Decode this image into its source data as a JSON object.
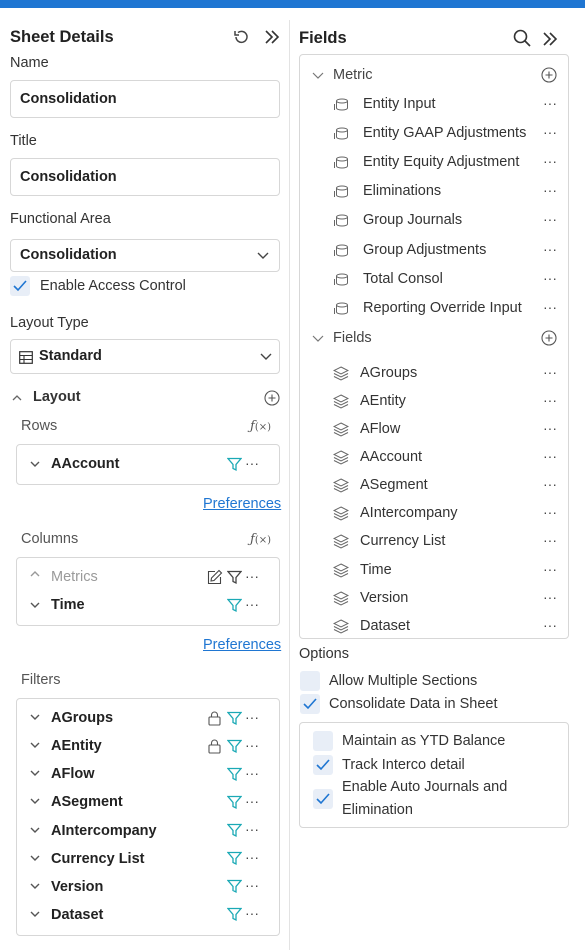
{
  "left": {
    "title": "Sheet Details",
    "name_label": "Name",
    "name_value": "Consolidation",
    "title_label": "Title",
    "title_value": "Consolidation",
    "functional_area_label": "Functional Area",
    "functional_area_value": "Consolidation",
    "enable_access_control": "Enable Access Control",
    "layout_type_label": "Layout Type",
    "layout_type_value": "Standard",
    "layout_section": "Layout",
    "rows_label": "Rows",
    "rows": [
      "AAccount"
    ],
    "preferences_1": "Preferences",
    "columns_label": "Columns",
    "columns": [
      "Metrics",
      "Time"
    ],
    "preferences_2": "Preferences",
    "filters_label": "Filters",
    "filters": [
      "AGroups",
      "AEntity",
      "AFlow",
      "ASegment",
      "AIntercompany",
      "Currency List",
      "Version",
      "Dataset"
    ]
  },
  "right": {
    "title": "Fields",
    "metric_group": "Metric",
    "metrics": [
      "Entity Input",
      "Entity GAAP Adjustments",
      "Entity Equity Adjustment",
      "Eliminations",
      "Group Journals",
      "Group Adjustments",
      "Total Consol",
      "Reporting Override Input"
    ],
    "fields_group": "Fields",
    "fields": [
      "AGroups",
      "AEntity",
      "AFlow",
      "AAccount",
      "ASegment",
      "AIntercompany",
      "Currency List",
      "Time",
      "Version",
      "Dataset"
    ],
    "options_label": "Options",
    "allow_multiple_sections": "Allow Multiple Sections",
    "consolidate_data": "Consolidate Data in Sheet",
    "maintain_ytd": "Maintain as YTD Balance",
    "track_interco": "Track Interco detail",
    "enable_auto_journals_1": "Enable Auto Journals and",
    "enable_auto_journals_2": "Elimination"
  },
  "icons": {
    "fx_label": "f(x)",
    "more": "···"
  },
  "colors": {
    "accent": "#1f76d2",
    "filter_teal": "#1ba9b5",
    "check_blue": "#1f76d2"
  }
}
